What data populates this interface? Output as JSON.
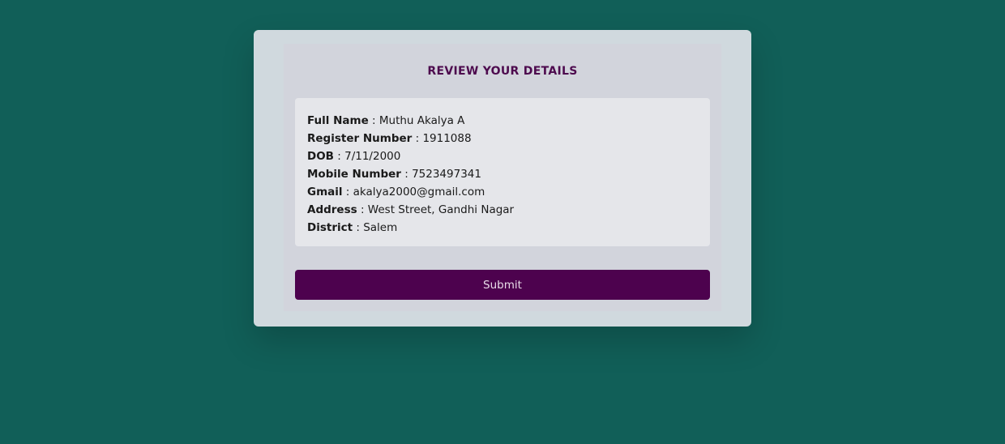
{
  "colors": {
    "background": "#115f58",
    "card": "#d0d9de",
    "panel": "#d2d4dc",
    "details_box": "#e5e6ea",
    "title": "#4d0a4e",
    "button": "#4d024e",
    "button_text": "#e9dde9"
  },
  "title": "REVIEW YOUR DETAILS",
  "details": [
    {
      "label": "Full Name",
      "value": " : Muthu Akalya A"
    },
    {
      "label": "Register Number",
      "value": " : 1911088"
    },
    {
      "label": "DOB",
      "value": " : 7/11/2000"
    },
    {
      "label": "Mobile Number",
      "value": " : 7523497341"
    },
    {
      "label": "Gmail",
      "value": " : akalya2000@gmail.com"
    },
    {
      "label": "Address",
      "value": " : West Street, Gandhi Nagar"
    },
    {
      "label": "District",
      "value": " : Salem"
    }
  ],
  "submit_label": "Submit"
}
